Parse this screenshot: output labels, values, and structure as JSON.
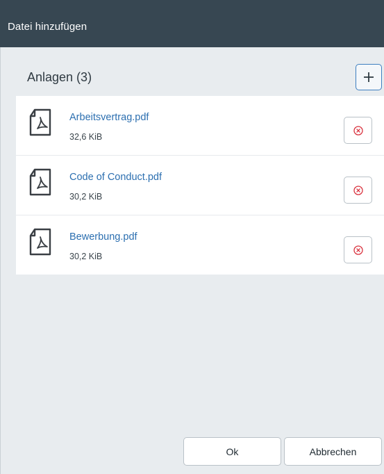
{
  "dialog": {
    "title": "Datei hinzufügen"
  },
  "attachments": {
    "heading": "Anlagen (3)",
    "add_icon": "plus-icon",
    "files": [
      {
        "name": "Arbeitsvertrag.pdf",
        "size": "32,6 KiB",
        "icon": "pdf-file-icon"
      },
      {
        "name": "Code of Conduct.pdf",
        "size": "30,2 KiB",
        "icon": "pdf-file-icon"
      },
      {
        "name": "Bewerbung.pdf",
        "size": "30,2 KiB",
        "icon": "pdf-file-icon"
      }
    ],
    "remove_icon": "remove-circle-x-icon"
  },
  "footer": {
    "ok_label": "Ok",
    "cancel_label": "Abbrechen"
  },
  "colors": {
    "titlebar": "#374752",
    "background": "#e8ecef",
    "link": "#2c6fb0",
    "remove_accent": "#d9333f",
    "add_border": "#3d7fc0"
  }
}
